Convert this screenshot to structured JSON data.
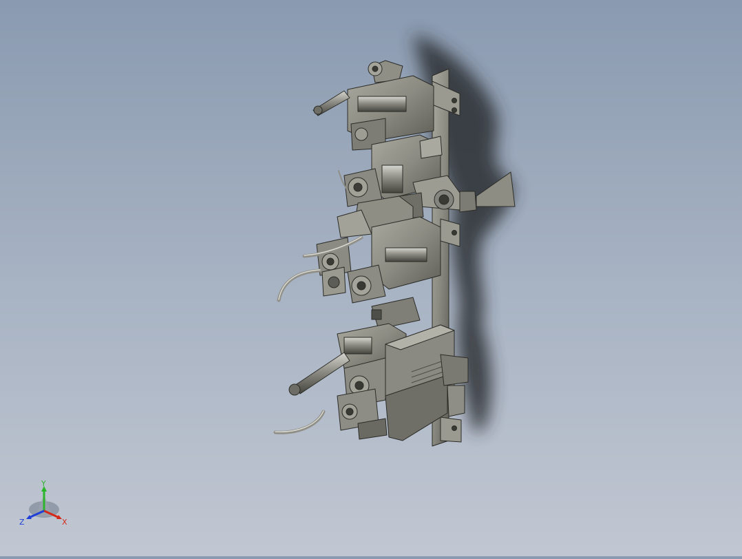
{
  "triad": {
    "x_label": "X",
    "y_label": "Y",
    "z_label": "Z",
    "x_color": "#d42a1a",
    "y_color": "#2bb52b",
    "z_color": "#1f3fd6"
  },
  "model": {
    "body_color": "#8d8d84",
    "shadow_color": "#2a2d33"
  }
}
